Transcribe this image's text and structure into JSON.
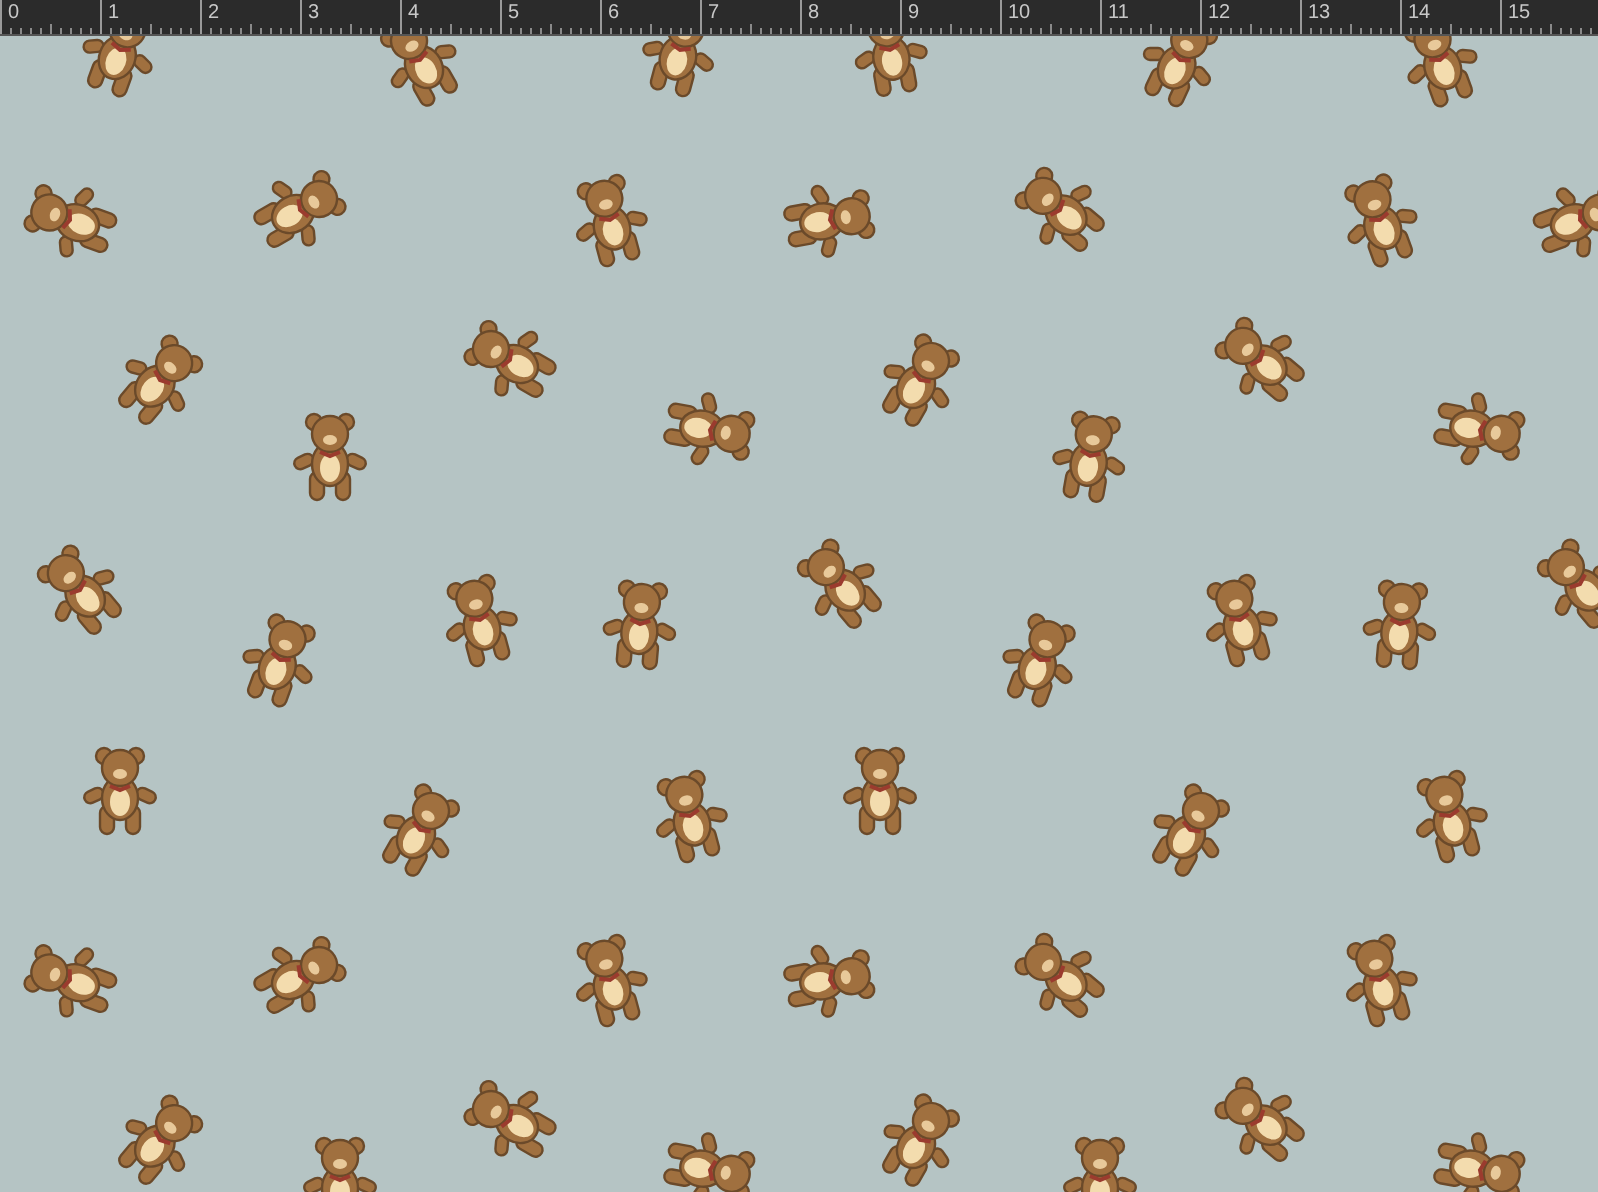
{
  "ruler": {
    "labels": [
      "0",
      "1",
      "2",
      "3",
      "4",
      "5",
      "6",
      "7",
      "8",
      "9",
      "10",
      "11",
      "12",
      "13",
      "14",
      "15"
    ]
  }
}
